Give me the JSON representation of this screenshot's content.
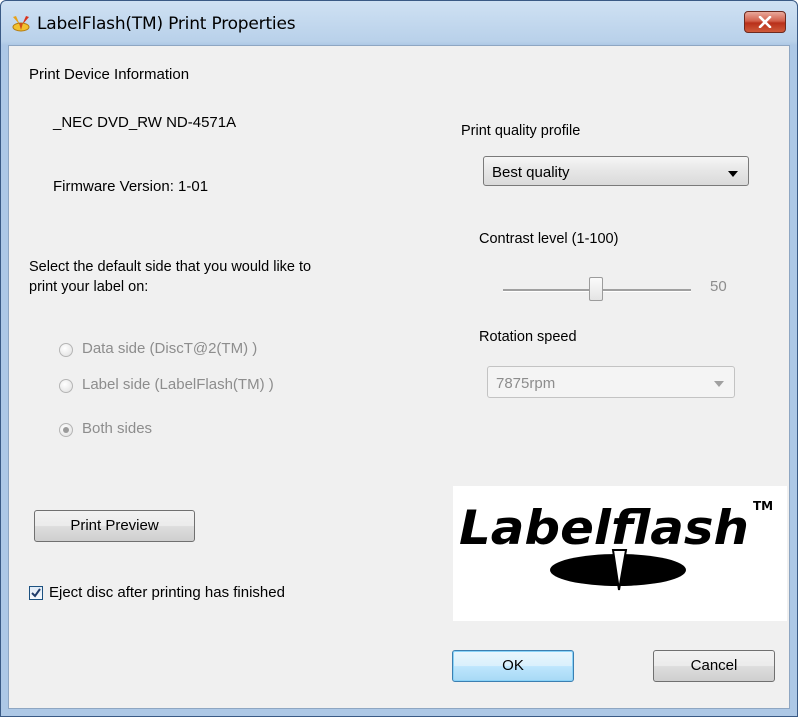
{
  "window": {
    "title": "LabelFlash(TM) Print Properties"
  },
  "device": {
    "section_label": "Print Device Information",
    "name": "_NEC DVD_RW ND-4571A",
    "firmware": "Firmware Version: 1-01"
  },
  "side": {
    "prompt": "Select the default side that you would like to print your label on:",
    "prompt_line1": "Select the default side that you would like to",
    "prompt_line2": "print your label on:",
    "options": [
      {
        "label": "Data side (DiscT@2(TM) )",
        "selected": false,
        "enabled": false
      },
      {
        "label": "Label side (LabelFlash(TM) )",
        "selected": false,
        "enabled": false
      },
      {
        "label": "Both sides",
        "selected": true,
        "enabled": false
      }
    ]
  },
  "quality": {
    "label": "Print quality profile",
    "value": "Best quality"
  },
  "contrast": {
    "label": "Contrast level (1-100)",
    "value": "50",
    "level": 50,
    "min": 1,
    "max": 100
  },
  "rotation": {
    "label": "Rotation speed",
    "value": "7875rpm",
    "enabled": false
  },
  "logo": {
    "text": "Labelflash",
    "tm": "TM"
  },
  "buttons": {
    "preview": "Print Preview",
    "ok": "OK",
    "cancel": "Cancel"
  },
  "eject": {
    "label": "Eject disc after printing has finished",
    "checked": true
  },
  "colors": {
    "title_bar": "#b9d1ea",
    "close_button": "#c8452c",
    "disabled_text": "#8d8d8d",
    "default_button_border": "#3c7fb1"
  }
}
